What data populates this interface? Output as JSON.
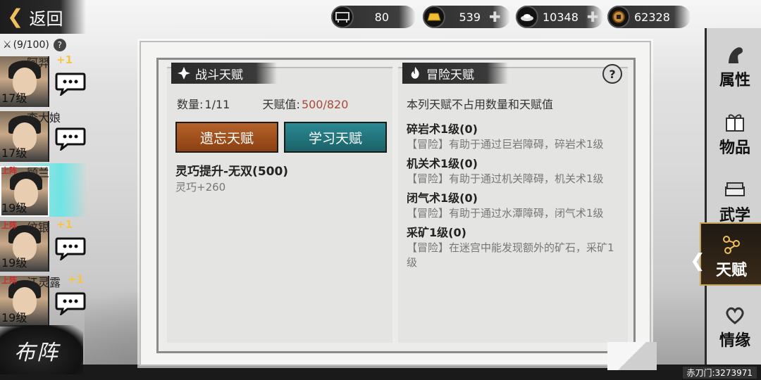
{
  "top_bar": {
    "back_label": "返回",
    "resources": [
      {
        "name": "stamina",
        "value": "80",
        "has_plus": false
      },
      {
        "name": "gold",
        "value": "539",
        "has_plus": true
      },
      {
        "name": "silver",
        "value": "10348",
        "has_plus": true
      },
      {
        "name": "coins",
        "value": "62328",
        "has_plus": false
      }
    ]
  },
  "roster": {
    "count": "(9/100)",
    "deployed_label": "上阵",
    "heroes": [
      {
        "name": "阿羿",
        "bonus": "+1",
        "level": "17级",
        "deployed": false
      },
      {
        "name": "李大娘",
        "bonus": "",
        "level": "17级",
        "deployed": false
      },
      {
        "name": "顾兰",
        "bonus": "",
        "level": "19级",
        "deployed": true
      },
      {
        "name": "纹银",
        "bonus": "+1",
        "level": "19级",
        "deployed": true
      },
      {
        "name": "江灵露",
        "bonus": "+1",
        "level": "19级",
        "deployed": true
      }
    ],
    "formation_label": "布阵"
  },
  "combat_talent": {
    "title": "战斗天赋",
    "count_label": "数量:",
    "count_value": "1/11",
    "points_label": "天赋值:",
    "points_value": "500/820",
    "forget_label": "遗忘天赋",
    "learn_label": "学习天赋",
    "learned": {
      "name": "灵巧提升-无双(500)",
      "desc": "灵巧+260"
    }
  },
  "adventure_talent": {
    "title": "冒险天赋",
    "note": "本列天赋不占用数量和天赋值",
    "items": [
      {
        "title": "碎岩术1级(0)",
        "desc": "【冒险】有助于通过巨岩障碍，碎岩术1级"
      },
      {
        "title": "机关术1级(0)",
        "desc": "【冒险】有助于通过机关障碍，机关术1级"
      },
      {
        "title": "闭气术1级(0)",
        "desc": "【冒险】有助于通过水潭障碍，闭气术1级"
      },
      {
        "title": "采矿1级(0)",
        "desc": "【冒险】在迷宫中能发现额外的矿石，采矿1级"
      }
    ]
  },
  "side_tabs": [
    {
      "label": "属性",
      "active": false
    },
    {
      "label": "物品",
      "active": false
    },
    {
      "label": "武学",
      "active": false
    },
    {
      "label": "天赋",
      "active": true
    },
    {
      "label": "情缘",
      "active": false
    }
  ],
  "server_id": "赤刀门:3273971",
  "colors": {
    "forget_button": "#a8521e",
    "learn_button": "#237681",
    "points_value": "#a84a3a",
    "bonus_text": "#f5c542",
    "deployed_text": "#d12a2a",
    "selected_highlight": "#64e6e6"
  }
}
